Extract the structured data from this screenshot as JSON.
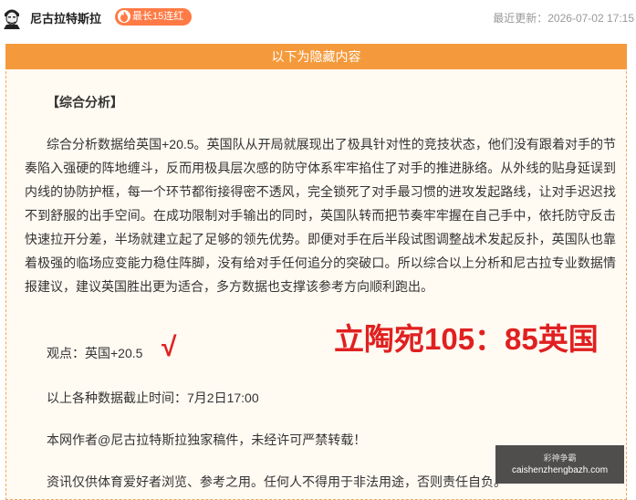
{
  "header": {
    "author": "尼古拉特斯拉",
    "streak_badge": "最长15连红",
    "updated": "最近更新：2026-07-02 17:15"
  },
  "panel": {
    "banner": "以下为隐藏内容",
    "section_title": "【综合分析】",
    "analysis": "综合分析数据给英国+20.5。英国队从开局就展现出了极具针对性的竞技状态，他们没有跟着对手的节奏陷入强硬的阵地缠斗，反而用极具层次感的防守体系牢牢掐住了对手的推进脉络。从外线的贴身延误到内线的协防护框，每一个环节都衔接得密不透风，完全锁死了对手最习惯的进攻发起路线，让对手迟迟找不到舒服的出手空间。在成功限制对手输出的同时，英国队转而把节奏牢牢握在自己手中，依托防守反击快速拉开分差，半场就建立起了足够的领先优势。即便对手在后半段试图调整战术发起反扑，英国队也靠着极强的临场应变能力稳住阵脚，没有给对手任何追分的突破口。所以综合以上分析和尼古拉专业数据情报建议，建议英国胜出更为适合，多方数据也支撑该参考方向顺利跑出。",
    "opinion": "观点：英国+20.5",
    "check": "√",
    "score_note": "立陶宛105：85英国",
    "cutoff": "以上各种数据截止时间：7月2日17:00",
    "copyright": "本网作者@尼古拉特斯拉独家稿件，未经许可严禁转载！",
    "disclaimer": "资讯仅供体育爱好者浏览、参考之用。任何人不得用于非法用途，否则责任自负。"
  },
  "watermark": {
    "line1": "彩神争霸",
    "line2": "caishenzhengbazh.com"
  },
  "colors": {
    "accent": "#f59a3c",
    "badge": "#ff7a45",
    "highlight": "#e02020",
    "panel_bg": "#fffaf2"
  }
}
